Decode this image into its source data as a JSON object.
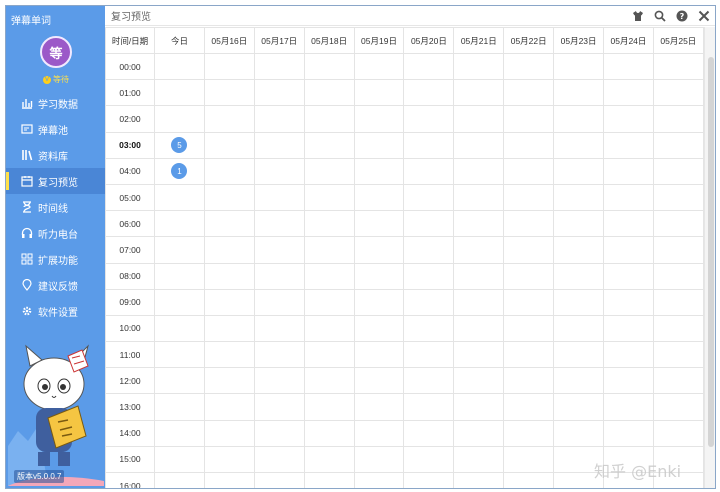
{
  "app": {
    "title": "弹幕单词"
  },
  "user": {
    "avatar_text": "等",
    "level_badge": "V",
    "level_text": "等待"
  },
  "sidebar": {
    "items": [
      {
        "label": "学习数据",
        "icon": "bar-chart-icon"
      },
      {
        "label": "弹幕池",
        "icon": "screen-icon"
      },
      {
        "label": "资料库",
        "icon": "library-icon"
      },
      {
        "label": "复习预览",
        "icon": "calendar-icon",
        "active": true
      },
      {
        "label": "时间线",
        "icon": "hourglass-icon"
      },
      {
        "label": "听力电台",
        "icon": "headphones-icon"
      },
      {
        "label": "扩展功能",
        "icon": "grid-icon"
      },
      {
        "label": "建议反馈",
        "icon": "location-pin-icon"
      },
      {
        "label": "软件设置",
        "icon": "gear-icon"
      }
    ],
    "version": "版本v5.0.0.7"
  },
  "header": {
    "title": "复习预览",
    "icons": [
      "shirt-icon",
      "search-icon",
      "help-icon",
      "close-icon"
    ]
  },
  "grid": {
    "corner_label": "时间/日期",
    "columns": [
      "今日",
      "05月16日",
      "05月17日",
      "05月18日",
      "05月19日",
      "05月20日",
      "05月21日",
      "05月22日",
      "05月23日",
      "05月24日",
      "05月25日"
    ],
    "rows": [
      {
        "time": "00:00",
        "today": ""
      },
      {
        "time": "01:00",
        "today": ""
      },
      {
        "time": "02:00",
        "today": ""
      },
      {
        "time": "03:00",
        "today": "5",
        "bold": true
      },
      {
        "time": "04:00",
        "today": "1"
      },
      {
        "time": "05:00",
        "today": ""
      },
      {
        "time": "06:00",
        "today": ""
      },
      {
        "time": "07:00",
        "today": ""
      },
      {
        "time": "08:00",
        "today": ""
      },
      {
        "time": "09:00",
        "today": ""
      },
      {
        "time": "10:00",
        "today": ""
      },
      {
        "time": "11:00",
        "today": ""
      },
      {
        "time": "12:00",
        "today": ""
      },
      {
        "time": "13:00",
        "today": ""
      },
      {
        "time": "14:00",
        "today": ""
      },
      {
        "time": "15:00",
        "today": ""
      },
      {
        "time": "16:00",
        "today": ""
      }
    ]
  },
  "watermark": "知乎 @Enki",
  "colors": {
    "sidebar": "#5b9be8",
    "accent": "#5b9be8",
    "avatar": "#9b59c8",
    "level": "#ffcf1a"
  }
}
